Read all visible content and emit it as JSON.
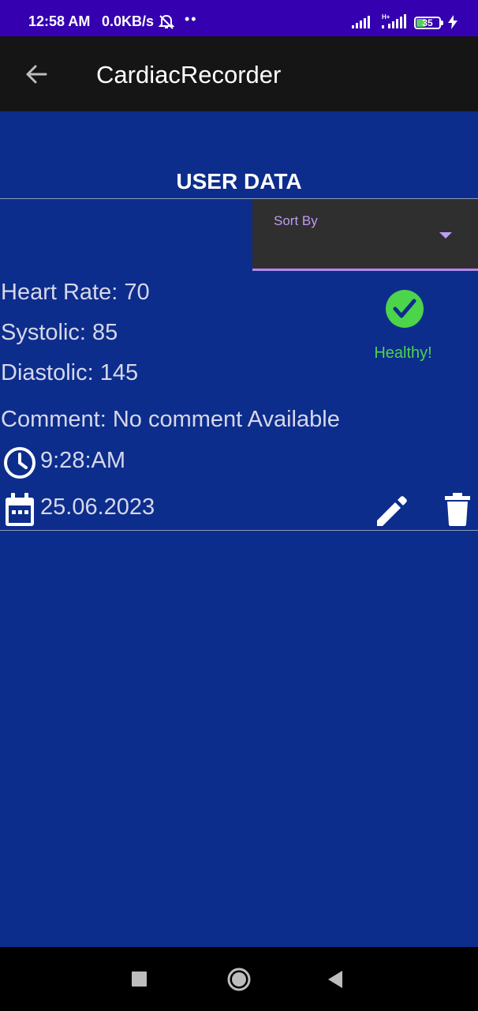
{
  "status_bar": {
    "time": "12:58 AM",
    "speed": "0.0KB/s",
    "battery": "35",
    "icons": [
      "mute-icon",
      "signal-icon",
      "hplus-signal-icon",
      "battery-icon",
      "charging-icon"
    ]
  },
  "app_bar": {
    "title": "CardiacRecorder",
    "back_icon": "arrow-left-icon"
  },
  "page": {
    "section_title": "USER DATA"
  },
  "sort": {
    "label": "Sort By"
  },
  "record": {
    "heart_rate": "Heart Rate: 70",
    "systolic": "Systolic: 85",
    "diastolic": "Diastolic: 145",
    "comment": "Comment: No comment Available",
    "time": "9:28:AM",
    "date": "25.06.2023",
    "status": "Healthy!"
  },
  "colors": {
    "background": "#0d2d8c",
    "status_bar": "#3500b0",
    "app_bar": "#151515",
    "accent": "#bf9bf5",
    "healthy": "#4cd44a"
  }
}
